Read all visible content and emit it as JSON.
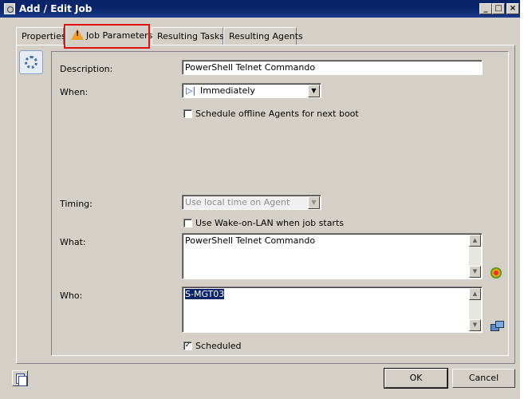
{
  "window": {
    "title": "Add / Edit Job",
    "minimize": "_",
    "maximize": "□",
    "close": "×"
  },
  "tabs": [
    {
      "label": "Properties",
      "warning": false
    },
    {
      "label": "Job Parameters",
      "warning": true
    },
    {
      "label": "Resulting Tasks",
      "warning": false
    },
    {
      "label": "Resulting Agents",
      "warning": false
    }
  ],
  "form": {
    "description": {
      "label": "Description:",
      "value": "PowerShell Telnet Commando"
    },
    "when": {
      "label": "When:",
      "value": "Immediately"
    },
    "schedule_offline": {
      "label": "Schedule offline Agents for next boot",
      "checked": false
    },
    "timing": {
      "label": "Timing:",
      "value": "Use local time on Agent"
    },
    "wake_on_lan": {
      "label": "Use Wake-on-LAN when job starts",
      "checked": false
    },
    "what": {
      "label": "What:",
      "value": "PowerShell Telnet Commando"
    },
    "who": {
      "label": "Who:",
      "value": "S-MGT03"
    },
    "scheduled": {
      "label": "Scheduled",
      "checked": true
    }
  },
  "buttons": {
    "ok": "OK",
    "cancel": "Cancel"
  },
  "icons": [
    "window-icon",
    "gear-settings-icon",
    "warning-icon",
    "gear-star-icon",
    "computers-icon",
    "copy-icon"
  ]
}
